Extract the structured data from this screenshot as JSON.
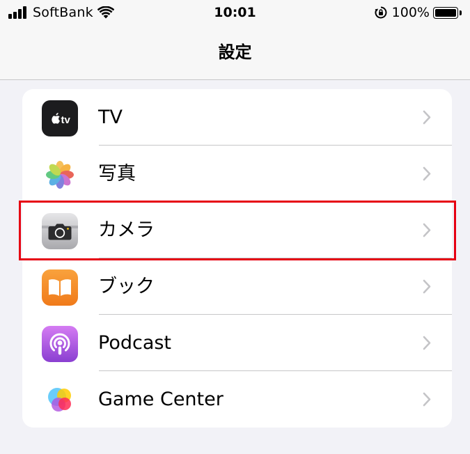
{
  "status_bar": {
    "carrier": "SoftBank",
    "time": "10:01",
    "battery_percent": "100%",
    "battery_level": 1.0,
    "signal_bars": 4,
    "wifi_icon": "wifi-icon",
    "orientation_lock_icon": "orientation-lock-icon"
  },
  "nav": {
    "title": "設定"
  },
  "settings": {
    "items": [
      {
        "label": "TV",
        "icon": "apple-tv-icon"
      },
      {
        "label": "写真",
        "icon": "photos-icon"
      },
      {
        "label": "カメラ",
        "icon": "camera-icon",
        "highlighted": true
      },
      {
        "label": "ブック",
        "icon": "books-icon"
      },
      {
        "label": "Podcast",
        "icon": "podcasts-icon"
      },
      {
        "label": "Game Center",
        "icon": "game-center-icon"
      }
    ]
  },
  "colors": {
    "background": "#f2f2f7",
    "card": "#ffffff",
    "separator": "#c6c6c8",
    "chevron": "#c4c4c7",
    "highlight": "#e60012"
  }
}
